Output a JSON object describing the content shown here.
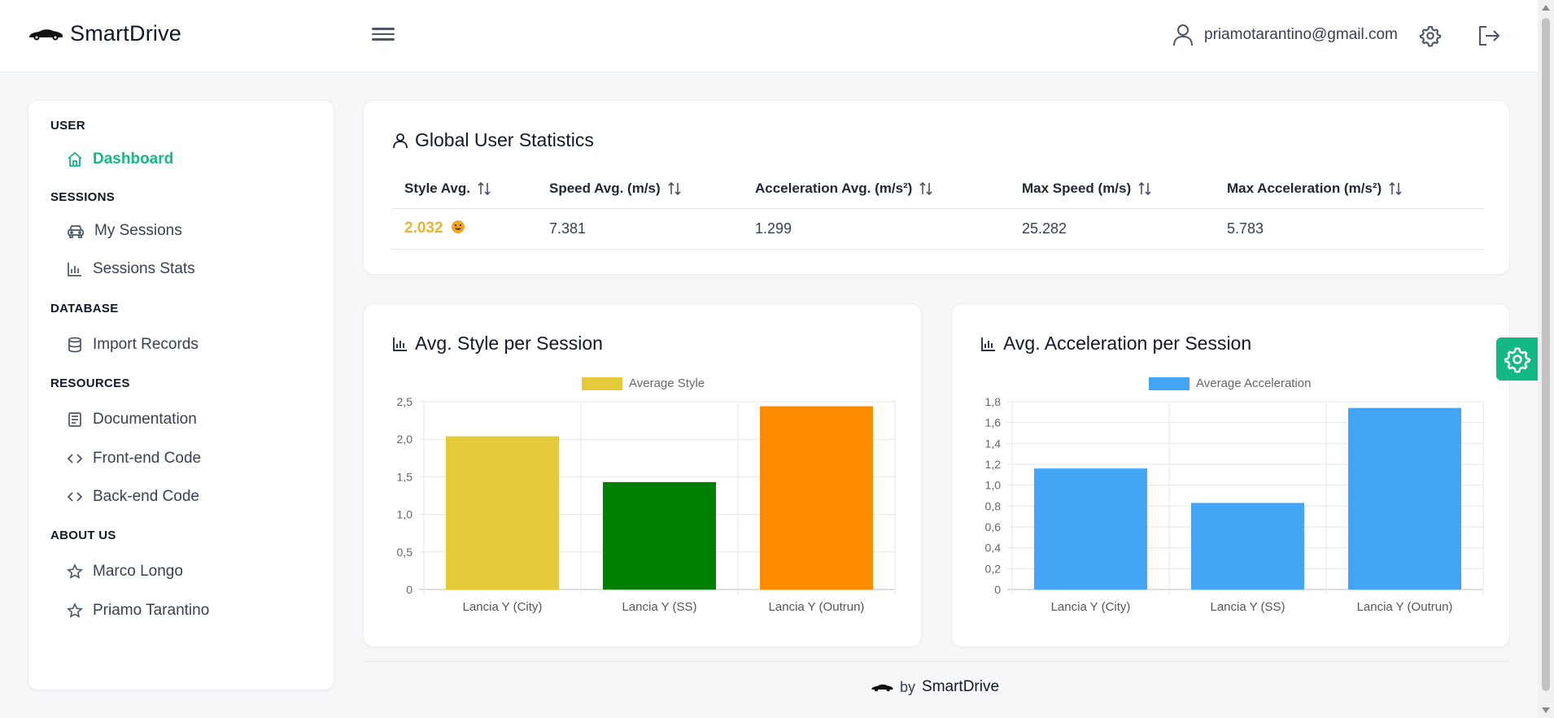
{
  "app": {
    "brand": "SmartDrive"
  },
  "header": {
    "user_email": "priamotarantino@gmail.com"
  },
  "sidebar": {
    "sections": [
      {
        "title": "USER",
        "items": [
          {
            "label": "Dashboard",
            "icon": "home-icon",
            "active": true
          }
        ]
      },
      {
        "title": "SESSIONS",
        "items": [
          {
            "label": "My Sessions",
            "icon": "car-icon"
          },
          {
            "label": "Sessions Stats",
            "icon": "bar-chart-icon"
          }
        ]
      },
      {
        "title": "DATABASE",
        "items": [
          {
            "label": "Import Records",
            "icon": "database-icon"
          }
        ]
      },
      {
        "title": "RESOURCES",
        "items": [
          {
            "label": "Documentation",
            "icon": "document-icon"
          },
          {
            "label": "Front-end Code",
            "icon": "code-icon"
          },
          {
            "label": "Back-end Code",
            "icon": "code-icon"
          }
        ]
      },
      {
        "title": "ABOUT US",
        "items": [
          {
            "label": "Marco Longo",
            "icon": "star-icon"
          },
          {
            "label": "Priamo Tarantino",
            "icon": "star-icon"
          }
        ]
      }
    ]
  },
  "stats": {
    "title": "Global User Statistics",
    "headers": [
      "Style Avg.",
      "Speed Avg. (m/s)",
      "Acceleration Avg. (m/s²)",
      "Max Speed (m/s)",
      "Max Acceleration (m/s²)"
    ],
    "row": {
      "style": "2.032",
      "speed": "7.381",
      "acceleration": "1.299",
      "max_speed": "25.282",
      "max_acceleration": "5.783"
    }
  },
  "chart_data": [
    {
      "type": "bar",
      "title": "Avg. Style per Session",
      "legend": "Average Style",
      "legend_color": "#e4c939",
      "categories": [
        "Lancia Y (City)",
        "Lancia Y (SS)",
        "Lancia Y (Outrun)"
      ],
      "values": [
        2.04,
        1.43,
        2.44
      ],
      "colors": [
        "#e4c939",
        "#008000",
        "#ff8c00"
      ],
      "ylim": [
        0,
        2.5
      ],
      "yticks": [
        "0",
        "0,5",
        "1,0",
        "1,5",
        "2,0",
        "2,5"
      ],
      "grid": true
    },
    {
      "type": "bar",
      "title": "Avg. Acceleration per Session",
      "legend": "Average Acceleration",
      "legend_color": "#42a5f5",
      "categories": [
        "Lancia Y (City)",
        "Lancia Y (SS)",
        "Lancia Y (Outrun)"
      ],
      "values": [
        1.16,
        0.83,
        1.74
      ],
      "colors": [
        "#42a5f5",
        "#42a5f5",
        "#42a5f5"
      ],
      "ylim": [
        0,
        1.8
      ],
      "yticks": [
        "0",
        "0,2",
        "0,4",
        "0,6",
        "0,8",
        "1,0",
        "1,2",
        "1,4",
        "1,6",
        "1,8"
      ],
      "grid": true
    }
  ],
  "footer": {
    "by": "by",
    "brand": "SmartDrive"
  }
}
